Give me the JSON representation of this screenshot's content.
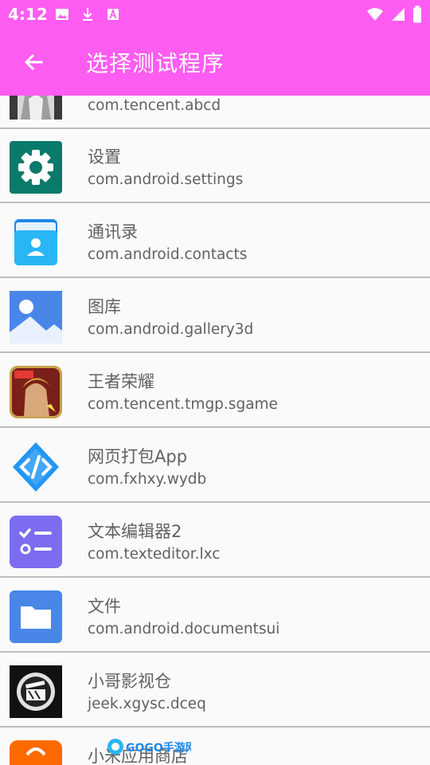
{
  "status_bar": {
    "time": "4:12",
    "left_icons": [
      "image-icon",
      "download-icon",
      "font-a-icon"
    ],
    "right_icons": [
      "wifi-icon",
      "cellular-signal-icon",
      "battery-icon"
    ]
  },
  "toolbar": {
    "back_icon": "arrow-back-icon",
    "title": "选择测试程序",
    "background_color": "#ff5cf1"
  },
  "apps": [
    {
      "name": "",
      "package": "com.tencent.abcd",
      "icon": "avatar-anime-icon"
    },
    {
      "name": "设置",
      "package": "com.android.settings",
      "icon": "settings-gear-icon"
    },
    {
      "name": "通讯录",
      "package": "com.android.contacts",
      "icon": "contacts-icon"
    },
    {
      "name": "图库",
      "package": "com.android.gallery3d",
      "icon": "gallery-icon"
    },
    {
      "name": "王者荣耀",
      "package": "com.tencent.tmgp.sgame",
      "icon": "honor-of-kings-icon"
    },
    {
      "name": "网页打包App",
      "package": "com.fxhxy.wydb",
      "icon": "code-brackets-icon"
    },
    {
      "name": "文本编辑器2",
      "package": "com.texteditor.lxc",
      "icon": "checklist-icon"
    },
    {
      "name": "文件",
      "package": "com.android.documentsui",
      "icon": "folder-icon"
    },
    {
      "name": "小哥影视仓",
      "package": "jeek.xgysc.dceq",
      "icon": "clapperboard-icon"
    },
    {
      "name": "小米应用商店",
      "package": "",
      "icon": "mi-store-icon"
    }
  ],
  "watermark": {
    "text": "GOGO手游网"
  }
}
